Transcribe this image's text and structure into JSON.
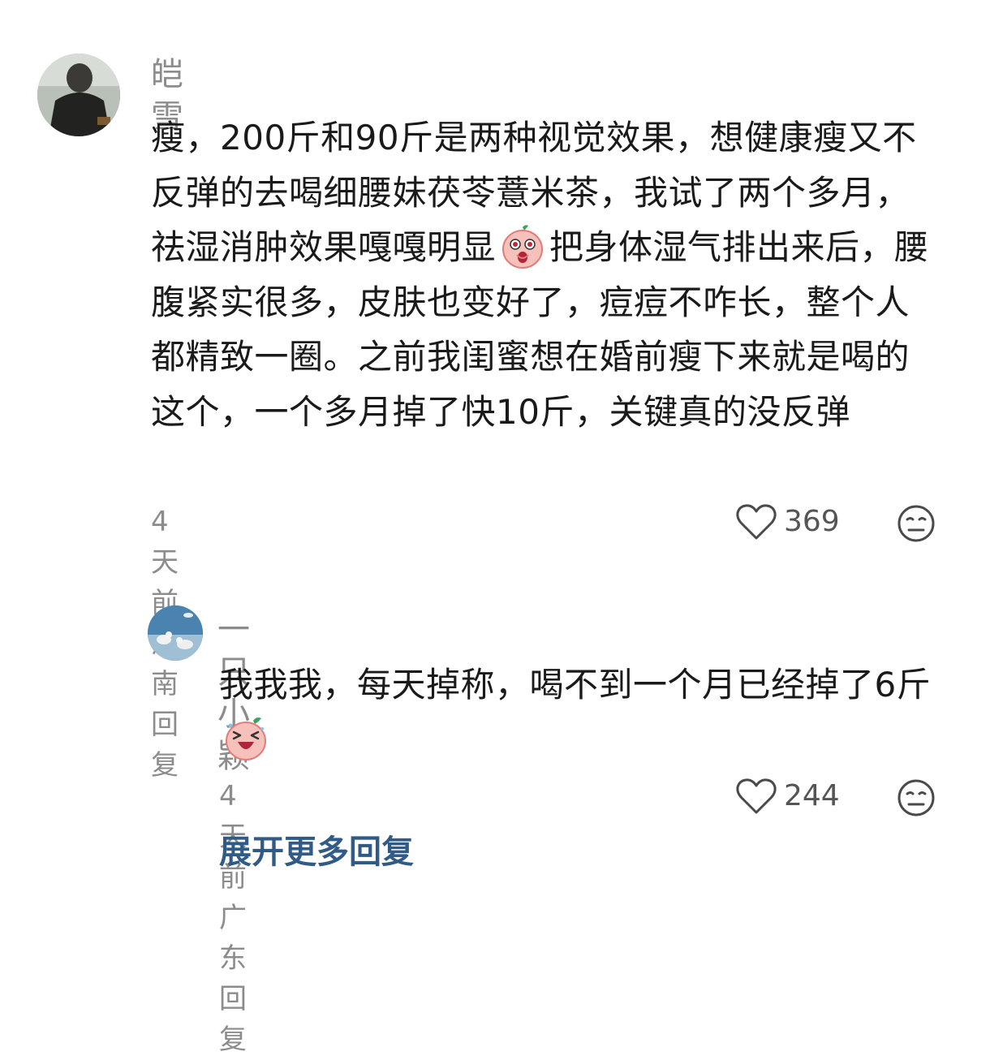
{
  "main_comment": {
    "username": "皑雪",
    "text_part1": "瘦，200斤和90斤是两种视觉效果，想健康瘦又不反弹的去喝细腰妹茯苓薏米茶，我试了两个多月，祛湿消肿效果嘎嘎明显",
    "text_part2": "把身体湿气排出来后，腰腹紧实很多，皮肤也变好了，痘痘不咋长，整个人都精致一圈。之前我闺蜜想在婚前瘦下来就是喝的这个，一个多月掉了快10斤，关键真的没反弹",
    "time": "4天前",
    "location": "湖南",
    "reply_label": "回复",
    "like_count": "369",
    "avatar_icon": "user-avatar-photo",
    "emoji_icon": "surprised-peach-emoji"
  },
  "reply_comment": {
    "username": "一只小颖",
    "text_part1": "我我我，每天掉称，喝不到一个月已经掉了6斤",
    "time": "4天前",
    "location": "广东",
    "reply_label": "回复",
    "like_count": "244",
    "avatar_icon": "seagull-avatar-photo",
    "emoji_icon": "laughing-peach-emoji"
  },
  "expand_label": "展开更多回复",
  "colors": {
    "text": "#1a1a1a",
    "meta": "#8c8c8c",
    "link": "#2f5b86"
  }
}
